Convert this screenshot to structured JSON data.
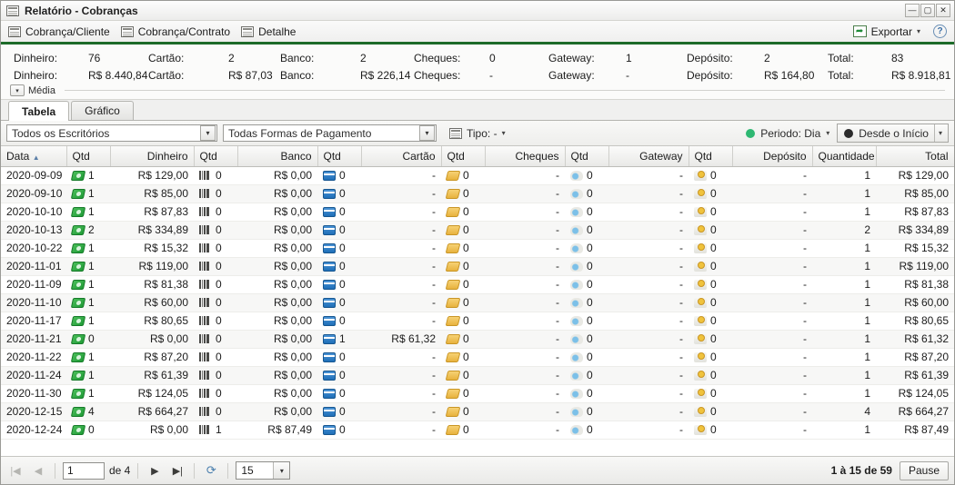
{
  "window": {
    "title": "Relatório - Cobranças",
    "icon": "report-icon",
    "minimize": "—",
    "maximize": "▢",
    "close": "✕"
  },
  "toolbar": {
    "items": [
      {
        "label": "Cobrança/Cliente",
        "icon": "grid-icon"
      },
      {
        "label": "Cobrança/Contrato",
        "icon": "grid-icon"
      },
      {
        "label": "Detalhe",
        "icon": "grid-icon"
      }
    ],
    "export_label": "Exportar",
    "export_caret": "▾",
    "help_label": "?"
  },
  "summary": {
    "counts": [
      {
        "label": "Dinheiro:",
        "value": "76"
      },
      {
        "label": "Cartão:",
        "value": "2"
      },
      {
        "label": "Banco:",
        "value": "2"
      },
      {
        "label": "Cheques:",
        "value": "0"
      },
      {
        "label": "Gateway:",
        "value": "1"
      },
      {
        "label": "Depósito:",
        "value": "2"
      },
      {
        "label": "Total:",
        "value": "83"
      }
    ],
    "amounts": [
      {
        "label": "Dinheiro:",
        "value": "R$ 8.440,84"
      },
      {
        "label": "Cartão:",
        "value": "R$ 87,03"
      },
      {
        "label": "Banco:",
        "value": "R$ 226,14"
      },
      {
        "label": "Cheques:",
        "value": "-"
      },
      {
        "label": "Gateway:",
        "value": "-"
      },
      {
        "label": "Depósito:",
        "value": "R$ 164,80"
      },
      {
        "label": "Total:",
        "value": "R$ 8.918,81"
      }
    ],
    "media_label": "Média",
    "media_caret": "▾"
  },
  "tabs": [
    {
      "label": "Tabela",
      "active": true
    },
    {
      "label": "Gráfico",
      "active": false
    }
  ],
  "filters": {
    "office": {
      "value": "Todos os Escritórios",
      "arrow": "▾"
    },
    "payment": {
      "value": "Todas Formas de Pagamento",
      "arrow": "▾"
    },
    "tipo": {
      "label": "Tipo: -",
      "caret": "▾",
      "icon": "grid-icon"
    },
    "periodo": {
      "label": "Periodo: Dia",
      "caret": "▾",
      "dot_color": "#2eb872"
    },
    "range": {
      "label": "Desde o Início",
      "caret": "▾",
      "dot_color": "#2b2b2b"
    }
  },
  "table": {
    "columns": [
      {
        "label": "Data",
        "align": "l",
        "sorted": true,
        "sort_arrow": "▲"
      },
      {
        "label": "Qtd",
        "align": "l"
      },
      {
        "label": "Dinheiro",
        "align": "r"
      },
      {
        "label": "Qtd",
        "align": "l"
      },
      {
        "label": "Banco",
        "align": "r"
      },
      {
        "label": "Qtd",
        "align": "l"
      },
      {
        "label": "Cartão",
        "align": "r"
      },
      {
        "label": "Qtd",
        "align": "l"
      },
      {
        "label": "Cheques",
        "align": "r"
      },
      {
        "label": "Qtd",
        "align": "l"
      },
      {
        "label": "Gateway",
        "align": "r"
      },
      {
        "label": "Qtd",
        "align": "l"
      },
      {
        "label": "Depósito",
        "align": "r"
      },
      {
        "label": "Quantidade",
        "align": "r"
      },
      {
        "label": "Total",
        "align": "r"
      }
    ],
    "rows": [
      {
        "data": "2020-09-09",
        "qtd_dinheiro": "1",
        "dinheiro": "R$ 129,00",
        "qtd_banco": "0",
        "banco": "R$ 0,00",
        "qtd_cartao": "0",
        "cartao": "-",
        "qtd_cheques": "0",
        "cheques": "-",
        "qtd_gateway": "0",
        "gateway": "-",
        "qtd_deposito": "0",
        "deposito": "-",
        "quantidade": "1",
        "total": "R$ 129,00"
      },
      {
        "data": "2020-09-10",
        "qtd_dinheiro": "1",
        "dinheiro": "R$ 85,00",
        "qtd_banco": "0",
        "banco": "R$ 0,00",
        "qtd_cartao": "0",
        "cartao": "-",
        "qtd_cheques": "0",
        "cheques": "-",
        "qtd_gateway": "0",
        "gateway": "-",
        "qtd_deposito": "0",
        "deposito": "-",
        "quantidade": "1",
        "total": "R$ 85,00"
      },
      {
        "data": "2020-10-10",
        "qtd_dinheiro": "1",
        "dinheiro": "R$ 87,83",
        "qtd_banco": "0",
        "banco": "R$ 0,00",
        "qtd_cartao": "0",
        "cartao": "-",
        "qtd_cheques": "0",
        "cheques": "-",
        "qtd_gateway": "0",
        "gateway": "-",
        "qtd_deposito": "0",
        "deposito": "-",
        "quantidade": "1",
        "total": "R$ 87,83"
      },
      {
        "data": "2020-10-13",
        "qtd_dinheiro": "2",
        "dinheiro": "R$ 334,89",
        "qtd_banco": "0",
        "banco": "R$ 0,00",
        "qtd_cartao": "0",
        "cartao": "-",
        "qtd_cheques": "0",
        "cheques": "-",
        "qtd_gateway": "0",
        "gateway": "-",
        "qtd_deposito": "0",
        "deposito": "-",
        "quantidade": "2",
        "total": "R$ 334,89"
      },
      {
        "data": "2020-10-22",
        "qtd_dinheiro": "1",
        "dinheiro": "R$ 15,32",
        "qtd_banco": "0",
        "banco": "R$ 0,00",
        "qtd_cartao": "0",
        "cartao": "-",
        "qtd_cheques": "0",
        "cheques": "-",
        "qtd_gateway": "0",
        "gateway": "-",
        "qtd_deposito": "0",
        "deposito": "-",
        "quantidade": "1",
        "total": "R$ 15,32"
      },
      {
        "data": "2020-11-01",
        "qtd_dinheiro": "1",
        "dinheiro": "R$ 119,00",
        "qtd_banco": "0",
        "banco": "R$ 0,00",
        "qtd_cartao": "0",
        "cartao": "-",
        "qtd_cheques": "0",
        "cheques": "-",
        "qtd_gateway": "0",
        "gateway": "-",
        "qtd_deposito": "0",
        "deposito": "-",
        "quantidade": "1",
        "total": "R$ 119,00"
      },
      {
        "data": "2020-11-09",
        "qtd_dinheiro": "1",
        "dinheiro": "R$ 81,38",
        "qtd_banco": "0",
        "banco": "R$ 0,00",
        "qtd_cartao": "0",
        "cartao": "-",
        "qtd_cheques": "0",
        "cheques": "-",
        "qtd_gateway": "0",
        "gateway": "-",
        "qtd_deposito": "0",
        "deposito": "-",
        "quantidade": "1",
        "total": "R$ 81,38"
      },
      {
        "data": "2020-11-10",
        "qtd_dinheiro": "1",
        "dinheiro": "R$ 60,00",
        "qtd_banco": "0",
        "banco": "R$ 0,00",
        "qtd_cartao": "0",
        "cartao": "-",
        "qtd_cheques": "0",
        "cheques": "-",
        "qtd_gateway": "0",
        "gateway": "-",
        "qtd_deposito": "0",
        "deposito": "-",
        "quantidade": "1",
        "total": "R$ 60,00"
      },
      {
        "data": "2020-11-17",
        "qtd_dinheiro": "1",
        "dinheiro": "R$ 80,65",
        "qtd_banco": "0",
        "banco": "R$ 0,00",
        "qtd_cartao": "0",
        "cartao": "-",
        "qtd_cheques": "0",
        "cheques": "-",
        "qtd_gateway": "0",
        "gateway": "-",
        "qtd_deposito": "0",
        "deposito": "-",
        "quantidade": "1",
        "total": "R$ 80,65"
      },
      {
        "data": "2020-11-21",
        "qtd_dinheiro": "0",
        "dinheiro": "R$ 0,00",
        "qtd_banco": "0",
        "banco": "R$ 0,00",
        "qtd_cartao": "1",
        "cartao": "R$ 61,32",
        "qtd_cheques": "0",
        "cheques": "-",
        "qtd_gateway": "0",
        "gateway": "-",
        "qtd_deposito": "0",
        "deposito": "-",
        "quantidade": "1",
        "total": "R$ 61,32"
      },
      {
        "data": "2020-11-22",
        "qtd_dinheiro": "1",
        "dinheiro": "R$ 87,20",
        "qtd_banco": "0",
        "banco": "R$ 0,00",
        "qtd_cartao": "0",
        "cartao": "-",
        "qtd_cheques": "0",
        "cheques": "-",
        "qtd_gateway": "0",
        "gateway": "-",
        "qtd_deposito": "0",
        "deposito": "-",
        "quantidade": "1",
        "total": "R$ 87,20"
      },
      {
        "data": "2020-11-24",
        "qtd_dinheiro": "1",
        "dinheiro": "R$ 61,39",
        "qtd_banco": "0",
        "banco": "R$ 0,00",
        "qtd_cartao": "0",
        "cartao": "-",
        "qtd_cheques": "0",
        "cheques": "-",
        "qtd_gateway": "0",
        "gateway": "-",
        "qtd_deposito": "0",
        "deposito": "-",
        "quantidade": "1",
        "total": "R$ 61,39"
      },
      {
        "data": "2020-11-30",
        "qtd_dinheiro": "1",
        "dinheiro": "R$ 124,05",
        "qtd_banco": "0",
        "banco": "R$ 0,00",
        "qtd_cartao": "0",
        "cartao": "-",
        "qtd_cheques": "0",
        "cheques": "-",
        "qtd_gateway": "0",
        "gateway": "-",
        "qtd_deposito": "0",
        "deposito": "-",
        "quantidade": "1",
        "total": "R$ 124,05"
      },
      {
        "data": "2020-12-15",
        "qtd_dinheiro": "4",
        "dinheiro": "R$ 664,27",
        "qtd_banco": "0",
        "banco": "R$ 0,00",
        "qtd_cartao": "0",
        "cartao": "-",
        "qtd_cheques": "0",
        "cheques": "-",
        "qtd_gateway": "0",
        "gateway": "-",
        "qtd_deposito": "0",
        "deposito": "-",
        "quantidade": "4",
        "total": "R$ 664,27"
      },
      {
        "data": "2020-12-24",
        "qtd_dinheiro": "0",
        "dinheiro": "R$ 0,00",
        "qtd_banco": "1",
        "banco": "R$ 87,49",
        "qtd_cartao": "0",
        "cartao": "-",
        "qtd_cheques": "0",
        "cheques": "-",
        "qtd_gateway": "0",
        "gateway": "-",
        "qtd_deposito": "0",
        "deposito": "-",
        "quantidade": "1",
        "total": "R$ 87,49"
      }
    ]
  },
  "statusbar": {
    "first": "|◀",
    "prev": "◀",
    "page_value": "1",
    "of_label": "de 4",
    "next": "▶",
    "last": "▶|",
    "refresh": "⟳",
    "page_size": "15",
    "page_size_arrow": "▾",
    "counter": "1 à 15 de 59",
    "pause_label": "Pause"
  }
}
